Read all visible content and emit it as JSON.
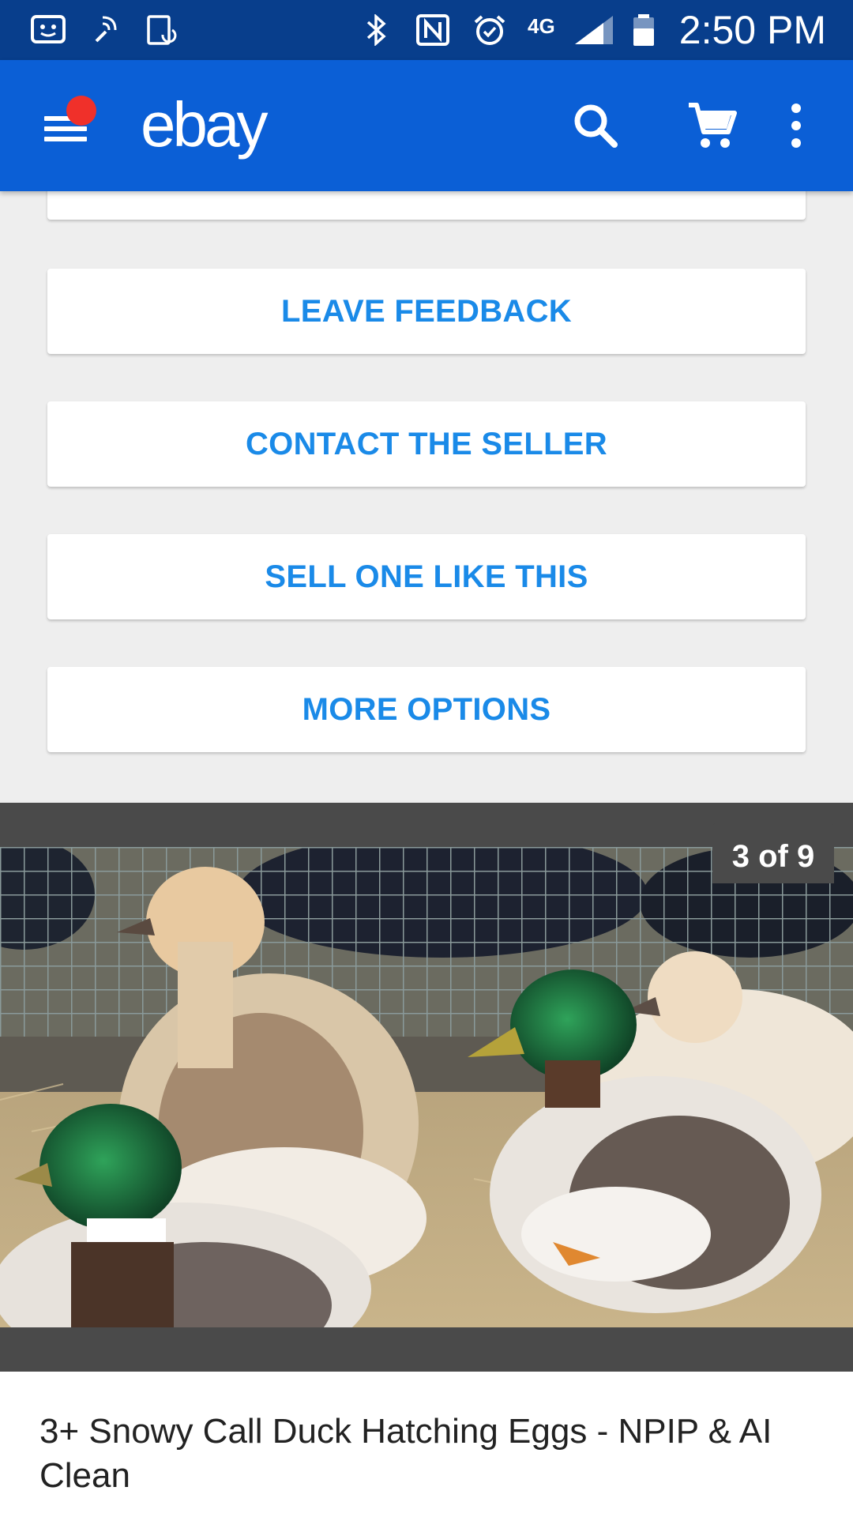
{
  "status_bar": {
    "time": "2:50 PM",
    "network": "4G",
    "icons": [
      "messenger-icon",
      "nfc-tap-icon",
      "screen-rotate-icon",
      "bluetooth-icon",
      "nfc-icon",
      "alarm-icon",
      "lte-icon",
      "signal-icon",
      "battery-icon"
    ]
  },
  "app_bar": {
    "logo": "ebay",
    "icons": [
      "menu-icon",
      "search-icon",
      "cart-icon",
      "more-vert-icon"
    ],
    "accent": "#0b5fd6",
    "notification_color": "#f0302a"
  },
  "actions": {
    "leave_feedback": "LEAVE FEEDBACK",
    "contact_seller": "CONTACT THE SELLER",
    "sell_one_like_this": "SELL ONE LIKE THIS",
    "more_options": "MORE OPTIONS",
    "label_color": "#1a8ae8"
  },
  "gallery": {
    "counter": "3 of 9"
  },
  "listing": {
    "title": "3+ Snowy Call Duck Hatching Eggs - NPIP & AI Clean"
  }
}
